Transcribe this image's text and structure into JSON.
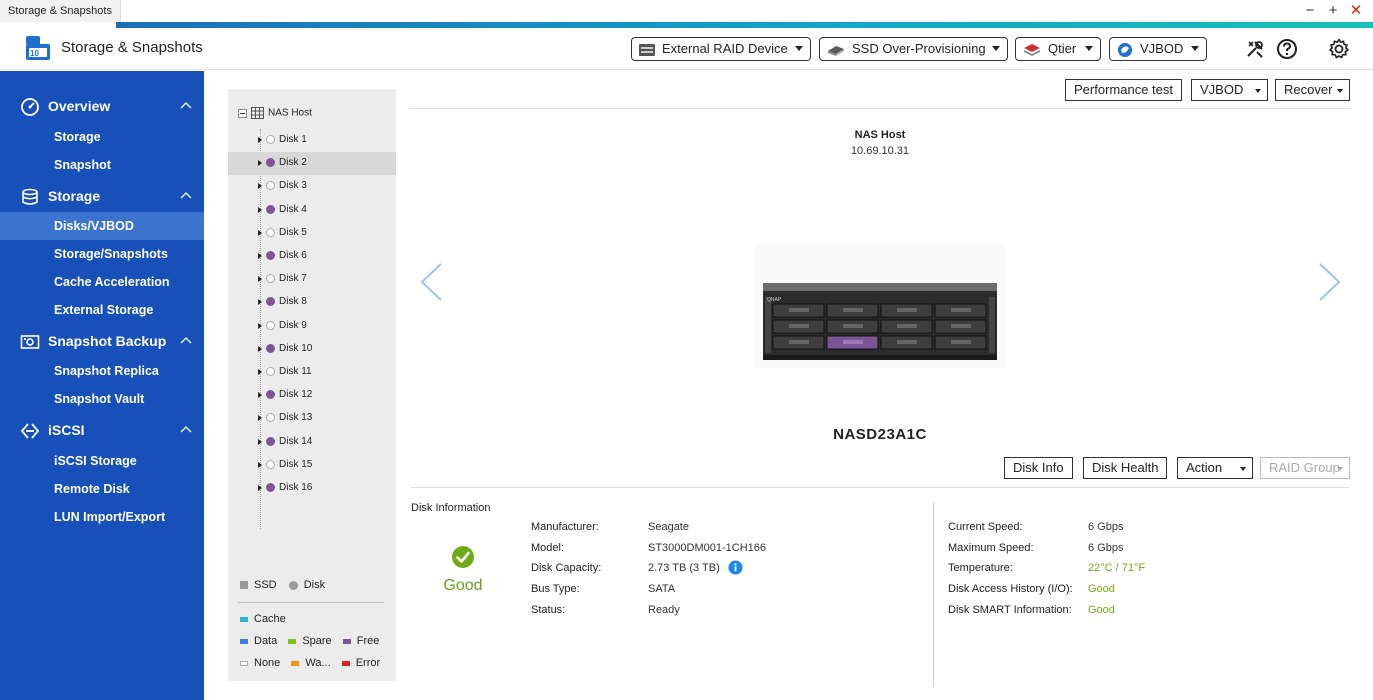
{
  "window": {
    "tab_title": "Storage & Snapshots",
    "minimize": "−",
    "maximize": "+",
    "close": "✕"
  },
  "header": {
    "app_title": "Storage & Snapshots",
    "buttons": [
      {
        "label": "External RAID Device",
        "icon": "external-raid-icon"
      },
      {
        "label": "SSD Over-Provisioning",
        "icon": "ssd-icon"
      },
      {
        "label": "Qtier",
        "icon": "qtier-icon"
      },
      {
        "label": "VJBOD",
        "icon": "vjbod-icon"
      }
    ],
    "icons": [
      "tools-icon",
      "help-icon",
      "settings-icon"
    ]
  },
  "sidebar": {
    "sections": [
      {
        "label": "Overview",
        "icon": "overview-icon",
        "items": [
          "Storage",
          "Snapshot"
        ]
      },
      {
        "label": "Storage",
        "icon": "storage-icon",
        "items": [
          "Disks/VJBOD",
          "Storage/Snapshots",
          "Cache Acceleration",
          "External Storage"
        ]
      },
      {
        "label": "Snapshot Backup",
        "icon": "snapshot-backup-icon",
        "items": [
          "Snapshot Replica",
          "Snapshot Vault"
        ]
      },
      {
        "label": "iSCSI",
        "icon": "iscsi-icon",
        "items": [
          "iSCSI Storage",
          "Remote Disk",
          "LUN Import/Export"
        ]
      }
    ],
    "active_item": "Disks/VJBOD"
  },
  "tree": {
    "root": "NAS Host",
    "disks": [
      {
        "label": "Disk 1",
        "filled": false
      },
      {
        "label": "Disk 2",
        "filled": true
      },
      {
        "label": "Disk 3",
        "filled": false
      },
      {
        "label": "Disk 4",
        "filled": true
      },
      {
        "label": "Disk 5",
        "filled": false
      },
      {
        "label": "Disk 6",
        "filled": true
      },
      {
        "label": "Disk 7",
        "filled": false
      },
      {
        "label": "Disk 8",
        "filled": true
      },
      {
        "label": "Disk 9",
        "filled": false
      },
      {
        "label": "Disk 10",
        "filled": true
      },
      {
        "label": "Disk 11",
        "filled": false
      },
      {
        "label": "Disk 12",
        "filled": true
      },
      {
        "label": "Disk 13",
        "filled": false
      },
      {
        "label": "Disk 14",
        "filled": true
      },
      {
        "label": "Disk 15",
        "filled": false
      },
      {
        "label": "Disk 16",
        "filled": true
      }
    ],
    "selected": "Disk 2",
    "legend_type": [
      {
        "label": "SSD",
        "shape": "square",
        "color": "#9a9a9a"
      },
      {
        "label": "Disk",
        "shape": "circle",
        "color": "#9a9a9a"
      }
    ],
    "legend_status": [
      {
        "label": "Cache",
        "color": "#2ab6c8"
      },
      {
        "label": "Data",
        "color": "#3d7de0"
      },
      {
        "label": "Spare",
        "color": "#7cc218"
      },
      {
        "label": "Free",
        "color": "#7b5596"
      },
      {
        "label": "None",
        "color": "#ffffff"
      },
      {
        "label": "Wa...",
        "color": "#f29412"
      },
      {
        "label": "Error",
        "color": "#d6251f"
      }
    ]
  },
  "toolbar": {
    "performance_test": "Performance test",
    "vjbod": "VJBOD",
    "recover": "Recover"
  },
  "host": {
    "name": "NAS Host",
    "ip": "10.69.10.31",
    "model": "NASD23A1C"
  },
  "disk_actions": {
    "disk_info": "Disk Info",
    "disk_health": "Disk Health",
    "action": "Action",
    "raid_group": "RAID Group"
  },
  "disk_info": {
    "title": "Disk Information",
    "status_text": "Good",
    "left": [
      {
        "key": "Manufacturer:",
        "value": "Seagate"
      },
      {
        "key": "Model:",
        "value": "ST3000DM001-1CH166"
      },
      {
        "key": "Disk Capacity:",
        "value": "2.73 TB (3 TB)"
      },
      {
        "key": "Bus Type:",
        "value": "SATA"
      },
      {
        "key": "Status:",
        "value": "Ready"
      }
    ],
    "right": [
      {
        "key": "Current Speed:",
        "value": "6 Gbps",
        "green": false
      },
      {
        "key": "Maximum Speed:",
        "value": "6 Gbps",
        "green": false
      },
      {
        "key": "Temperature:",
        "value": "22°C / 71°F",
        "green": true
      },
      {
        "key": "Disk Access History (I/O):",
        "value": "Good",
        "green": true
      },
      {
        "key": "Disk SMART Information:",
        "value": "Good",
        "green": true
      }
    ]
  }
}
